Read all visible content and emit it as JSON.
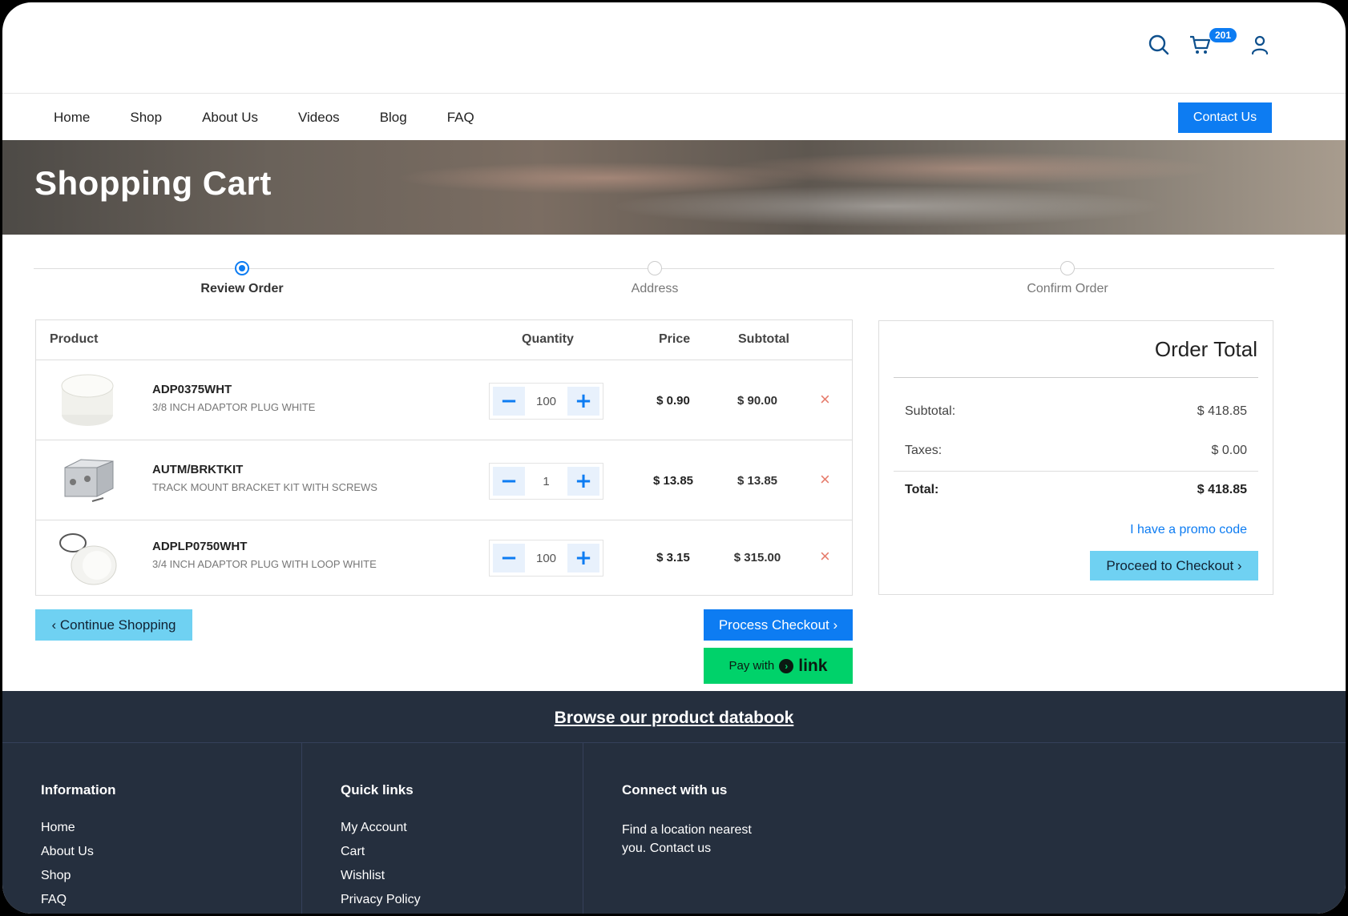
{
  "header": {
    "cart_count": "201"
  },
  "nav": {
    "items": [
      "Home",
      "Shop",
      "About Us",
      "Videos",
      "Blog",
      "FAQ"
    ],
    "contact_label": "Contact Us"
  },
  "banner": {
    "title": "Shopping Cart"
  },
  "stepper": {
    "steps": [
      "Review Order",
      "Address",
      "Confirm Order"
    ],
    "active": 0
  },
  "cart": {
    "headers": {
      "product": "Product",
      "quantity": "Quantity",
      "price": "Price",
      "subtotal": "Subtotal"
    },
    "rows": [
      {
        "sku": "ADP0375WHT",
        "desc": "3/8 INCH ADAPTOR PLUG WHITE",
        "qty": "100",
        "price": "$ 0.90",
        "subtotal": "$ 90.00"
      },
      {
        "sku": "AUTM/BRKTKIT",
        "desc": "TRACK MOUNT BRACKET KIT WITH SCREWS",
        "qty": "1",
        "price": "$ 13.85",
        "subtotal": "$ 13.85"
      },
      {
        "sku": "ADPLP0750WHT",
        "desc": "3/4 INCH ADAPTOR PLUG WITH LOOP WHITE",
        "qty": "100",
        "price": "$ 3.15",
        "subtotal": "$ 315.00"
      }
    ],
    "continue_label": "Continue Shopping",
    "process_label": "Process Checkout",
    "pay_with": "Pay with",
    "link_word": "link"
  },
  "order_total": {
    "title": "Order Total",
    "subtotal_label": "Subtotal:",
    "subtotal_value": "$ 418.85",
    "taxes_label": "Taxes:",
    "taxes_value": "$ 0.00",
    "total_label": "Total:",
    "total_value": "$ 418.85",
    "promo_label": "I have a promo code",
    "proceed_label": "Proceed to Checkout"
  },
  "footer": {
    "databook": "Browse our product databook",
    "information": {
      "title": "Information",
      "links": [
        "Home",
        "About Us",
        "Shop",
        "FAQ"
      ]
    },
    "quick_links": {
      "title": "Quick links",
      "links": [
        "My Account",
        "Cart",
        "Wishlist",
        "Privacy Policy"
      ]
    },
    "connect": {
      "title": "Connect with us",
      "text": "Find a location nearest you. Contact us"
    }
  },
  "colors": {
    "primary": "#0d7cf2",
    "light_button": "#6fd1f2",
    "link_green": "#00d26a",
    "footer_bg": "#252f3e"
  }
}
